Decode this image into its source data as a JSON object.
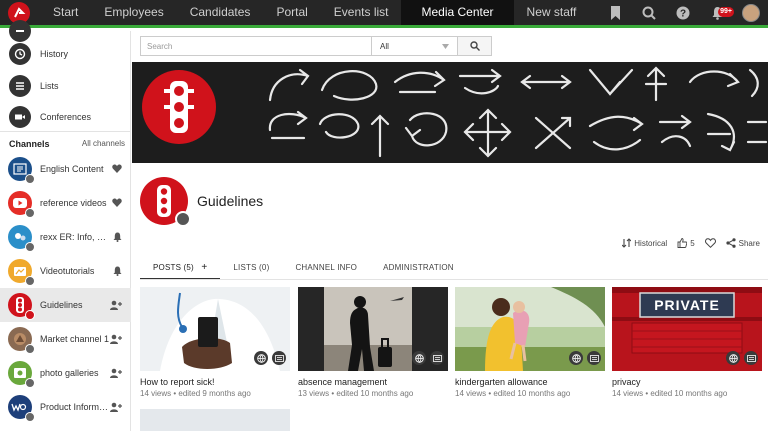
{
  "nav": {
    "items": [
      "Start",
      "Employees",
      "Candidates",
      "Portal",
      "Events list",
      "Media Center",
      "New staff"
    ],
    "active": "Media Center",
    "notifications_badge": "99+"
  },
  "sidebar": {
    "links": [
      {
        "label": "History",
        "icon": "history-icon"
      },
      {
        "label": "Lists",
        "icon": "list-icon"
      },
      {
        "label": "Conferences",
        "icon": "video-camera-icon"
      }
    ],
    "channels_title": "Channels",
    "channels_all": "All channels",
    "channels": [
      {
        "label": "English Content",
        "action": "heart-icon",
        "color": "#1b4f8a"
      },
      {
        "label": "reference videos",
        "action": "heart-icon",
        "color": "#e52d27"
      },
      {
        "label": "rexx ER: Info, updates",
        "action": "bell-icon",
        "color": "#2b8fc9"
      },
      {
        "label": "Videotutorials",
        "action": "bell-icon",
        "color": "#f0a92c"
      },
      {
        "label": "Guidelines",
        "action": "add-user-icon",
        "color": "#d0121b"
      },
      {
        "label": "Market channel 1",
        "action": "add-user-icon",
        "color": "#8a6a52"
      },
      {
        "label": "photo galleries",
        "action": "add-user-icon",
        "color": "#6aa83c"
      },
      {
        "label": "Product Information",
        "action": "add-user-icon",
        "color": "#1d3f7a"
      }
    ]
  },
  "search": {
    "placeholder": "Search",
    "select_value": "All"
  },
  "channel": {
    "title": "Guidelines",
    "historical_label": "Historical",
    "likes": "5",
    "share_label": "Share"
  },
  "tabs": [
    "POSTS (5)",
    "LISTS (0)",
    "CHANNEL INFO",
    "ADMINISTRATION"
  ],
  "tab_add": "+",
  "posts": [
    {
      "title": "How to report sick!",
      "meta": "14 views • edited 9 months ago"
    },
    {
      "title": "absence management",
      "meta": "13 views • edited 10 months ago"
    },
    {
      "title": "kindergarten allowance",
      "meta": "14 views • edited 10 months ago"
    },
    {
      "title": "privacy",
      "meta": "14 views • edited 10 months ago",
      "sign_text": "PRIVATE"
    }
  ],
  "colors": {
    "brand_red": "#d0121b",
    "nav_bg": "#262626",
    "nav_accent": "#3aab3a"
  }
}
